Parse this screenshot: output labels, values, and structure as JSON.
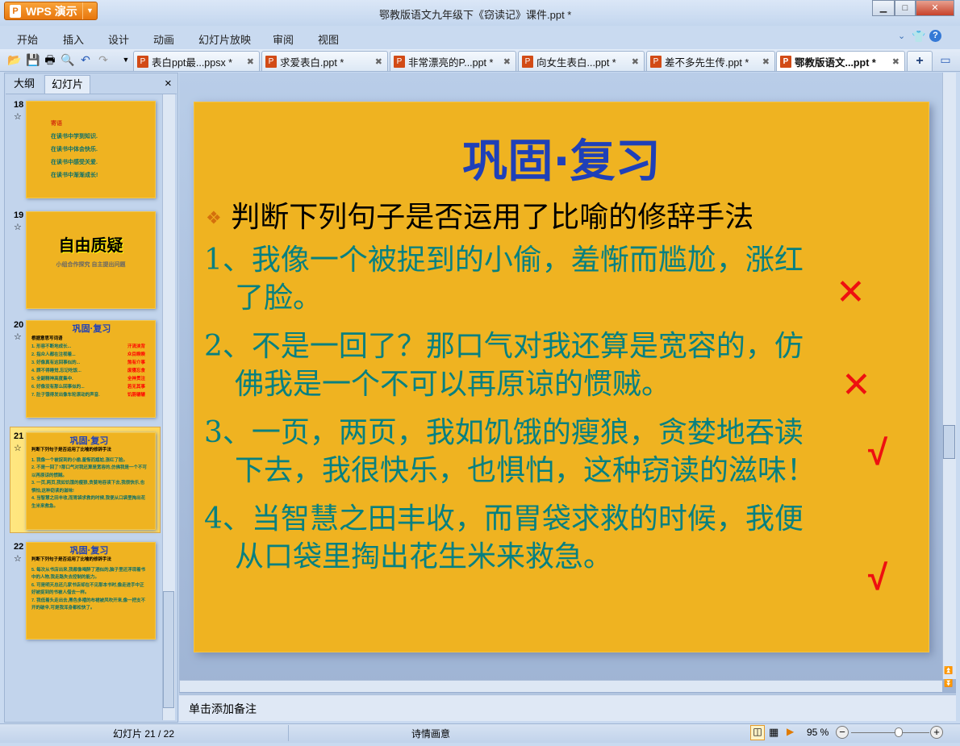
{
  "app": {
    "button_label": "WPS 演示",
    "window_title": "鄂教版语文九年级下《窃读记》课件.ppt *"
  },
  "menu": [
    "开始",
    "插入",
    "设计",
    "动画",
    "幻灯片放映",
    "审阅",
    "视图"
  ],
  "tabs": [
    {
      "label": "表白ppt最...ppsx *"
    },
    {
      "label": "求爱表白.ppt *"
    },
    {
      "label": "非常漂亮的P...ppt *"
    },
    {
      "label": "向女生表白...ppt *"
    },
    {
      "label": "差不多先生传.ppt *"
    },
    {
      "label": "鄂教版语文...ppt *",
      "active": true
    }
  ],
  "left_panel": {
    "tab_outline": "大纲",
    "tab_slides": "幻灯片",
    "close": "×"
  },
  "thumbnails": [
    {
      "num": "18",
      "lines": [
        "寄语",
        "在读书中学到知识.",
        "在读书中体会快乐.",
        "在读书中感受关爱.",
        "在读书中渐渐成长!"
      ]
    },
    {
      "num": "19",
      "title": "自由质疑",
      "sub": "小组合作探究  自主提出问题"
    },
    {
      "num": "20",
      "title": "巩固·复习",
      "heading": "根据意思写词语",
      "lines": [
        "1. 形容不断地成长...",
        "2. 指众人都在注视着...",
        "3. 好像真有这回事似的...",
        "4. 顾不得睡觉,忘记吃饭...",
        "5. 全副精神高度集中.",
        "6. 好像没有那么回事似的...",
        "7. 肚子饿得发出像车轮滚动的声音."
      ],
      "answers": [
        "汗流浃背",
        "众目睽睽",
        "煞有介事",
        "废寝忘食",
        "全神贯注",
        "若无其事",
        "饥肠辘辘"
      ]
    },
    {
      "num": "21",
      "title": "巩固·复习",
      "heading": "判断下列句子是否运用了比喻的修辞手法",
      "lines": [
        "1. 我像一个被捉到的小偷,羞惭而尴尬,涨红了脸。",
        "2. 不是一回了?那口气对我还算是宽容的,仿佛我是一个不可以再原谅的惯贼。",
        "3. 一页,两页,我如饥饿的瘦狼,贪婪地吞读下去,我很快乐,也惧怕,这种窃读的滋味!",
        "4. 当智慧之田丰收,而胃袋求救的时候,我便从口袋里掏出花生米来救急。"
      ]
    },
    {
      "num": "22",
      "title": "巩固·复习",
      "heading": "判断下列句子是否运用了比喻的修辞手法",
      "lines": [
        "5. 每次从书店出来,我都像喝醉了酒似的,脑子里还浮现着书中的人物,我走路失去控制的能力。",
        "6. 可是明天总还几家书店却在不见那本书时,像走进手中正好被捉到的书被人借去一样。",
        "7. 我低着头走出去,黑色多褶的布裙被风吹开来,像一把支不开的破伞,可是我浑身都松快了。"
      ]
    }
  ],
  "slide": {
    "title": "巩固·复习",
    "bullet": "判断下列句子是否运用了比喻的修辞手法",
    "items": [
      {
        "l1": "1、我像一个被捉到的小偷，羞惭而尴尬，涨红",
        "l2": "了脸。",
        "mark": "✕"
      },
      {
        "l1": "2、不是一回了？那口气对我还算是宽容的，仿",
        "l2": "佛我是一个不可以再原谅的惯贼。",
        "mark": "✕"
      },
      {
        "l1": "3、一页，两页，我如饥饿的瘦狼，贪婪地吞读",
        "l2": "下去，我很快乐，也惧怕，这种窃读的滋味！",
        "mark": "√"
      },
      {
        "l1": "4、当智慧之田丰收，而胃袋求救的时候，我便",
        "l2": "从口袋里掏出花生米来救急。",
        "mark": "√"
      }
    ]
  },
  "notes_placeholder": "单击添加备注",
  "status": {
    "slide_count": "幻灯片 21 / 22",
    "theme": "诗情画意",
    "zoom": "95 %",
    "zoom_percent": 95
  },
  "colors": {
    "slide_bg": "#EFB321",
    "title": "#1F40B8",
    "body": "#078080",
    "mark": "#EE1010"
  }
}
